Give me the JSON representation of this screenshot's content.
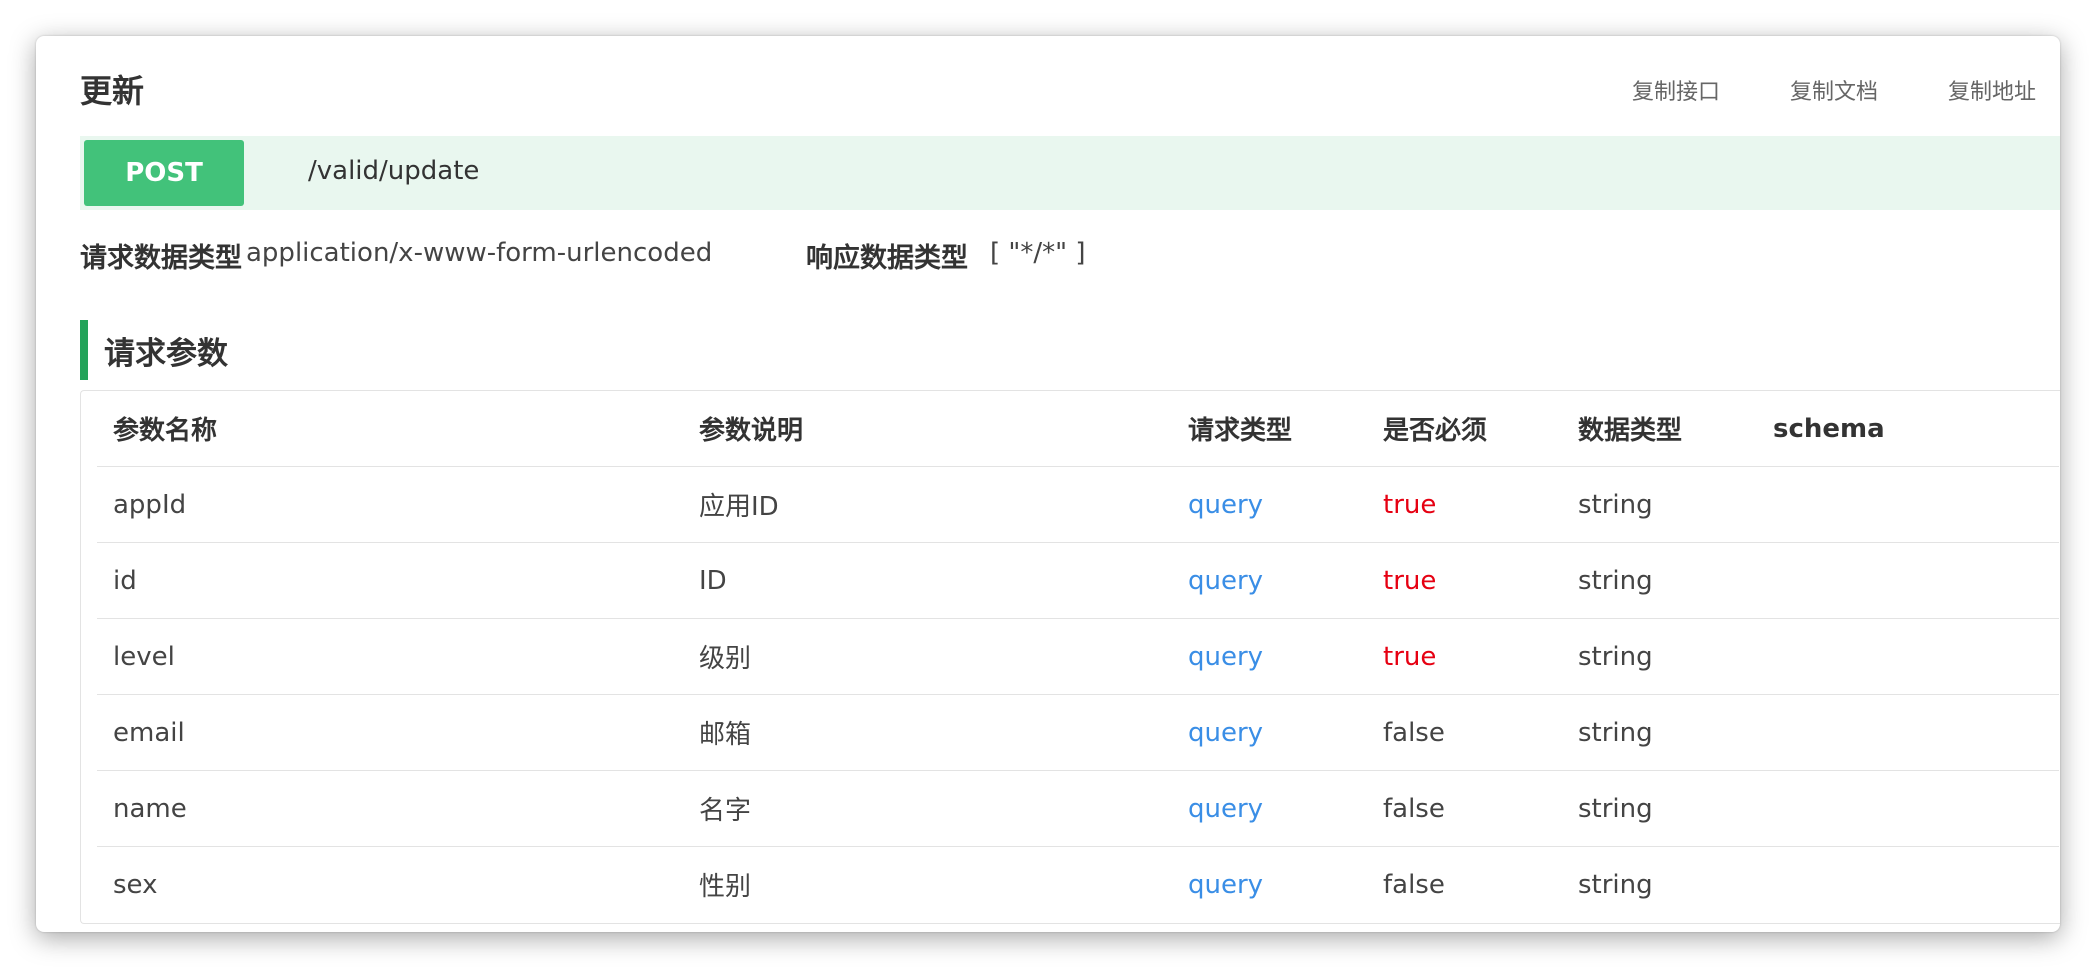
{
  "header": {
    "title": "更新",
    "actions": [
      "复制接口",
      "复制文档",
      "复制地址"
    ]
  },
  "endpoint": {
    "method": "POST",
    "path": "/valid/update"
  },
  "meta": {
    "request_label": "请求数据类型",
    "request_value": "application/x-www-form-urlencoded",
    "response_label": "响应数据类型",
    "response_value": "[ \"*/*\" ]"
  },
  "params": {
    "section_title": "请求参数",
    "columns": [
      "参数名称",
      "参数说明",
      "请求类型",
      "是否必须",
      "数据类型",
      "schema"
    ],
    "rows": [
      {
        "name": "appId",
        "desc": "应用ID",
        "in": "query",
        "required": "true",
        "type": "string",
        "schema": ""
      },
      {
        "name": "id",
        "desc": "ID",
        "in": "query",
        "required": "true",
        "type": "string",
        "schema": ""
      },
      {
        "name": "level",
        "desc": "级别",
        "in": "query",
        "required": "true",
        "type": "string",
        "schema": ""
      },
      {
        "name": "email",
        "desc": "邮箱",
        "in": "query",
        "required": "false",
        "type": "string",
        "schema": ""
      },
      {
        "name": "name",
        "desc": "名字",
        "in": "query",
        "required": "false",
        "type": "string",
        "schema": ""
      },
      {
        "name": "sex",
        "desc": "性别",
        "in": "query",
        "required": "false",
        "type": "string",
        "schema": ""
      }
    ]
  },
  "colors": {
    "method_bg": "#42c27a",
    "method_bar_bg": "#e9f7ef",
    "section_accent": "#24a35a",
    "query_text": "#3a8ee6",
    "required_true": "#e60012"
  }
}
